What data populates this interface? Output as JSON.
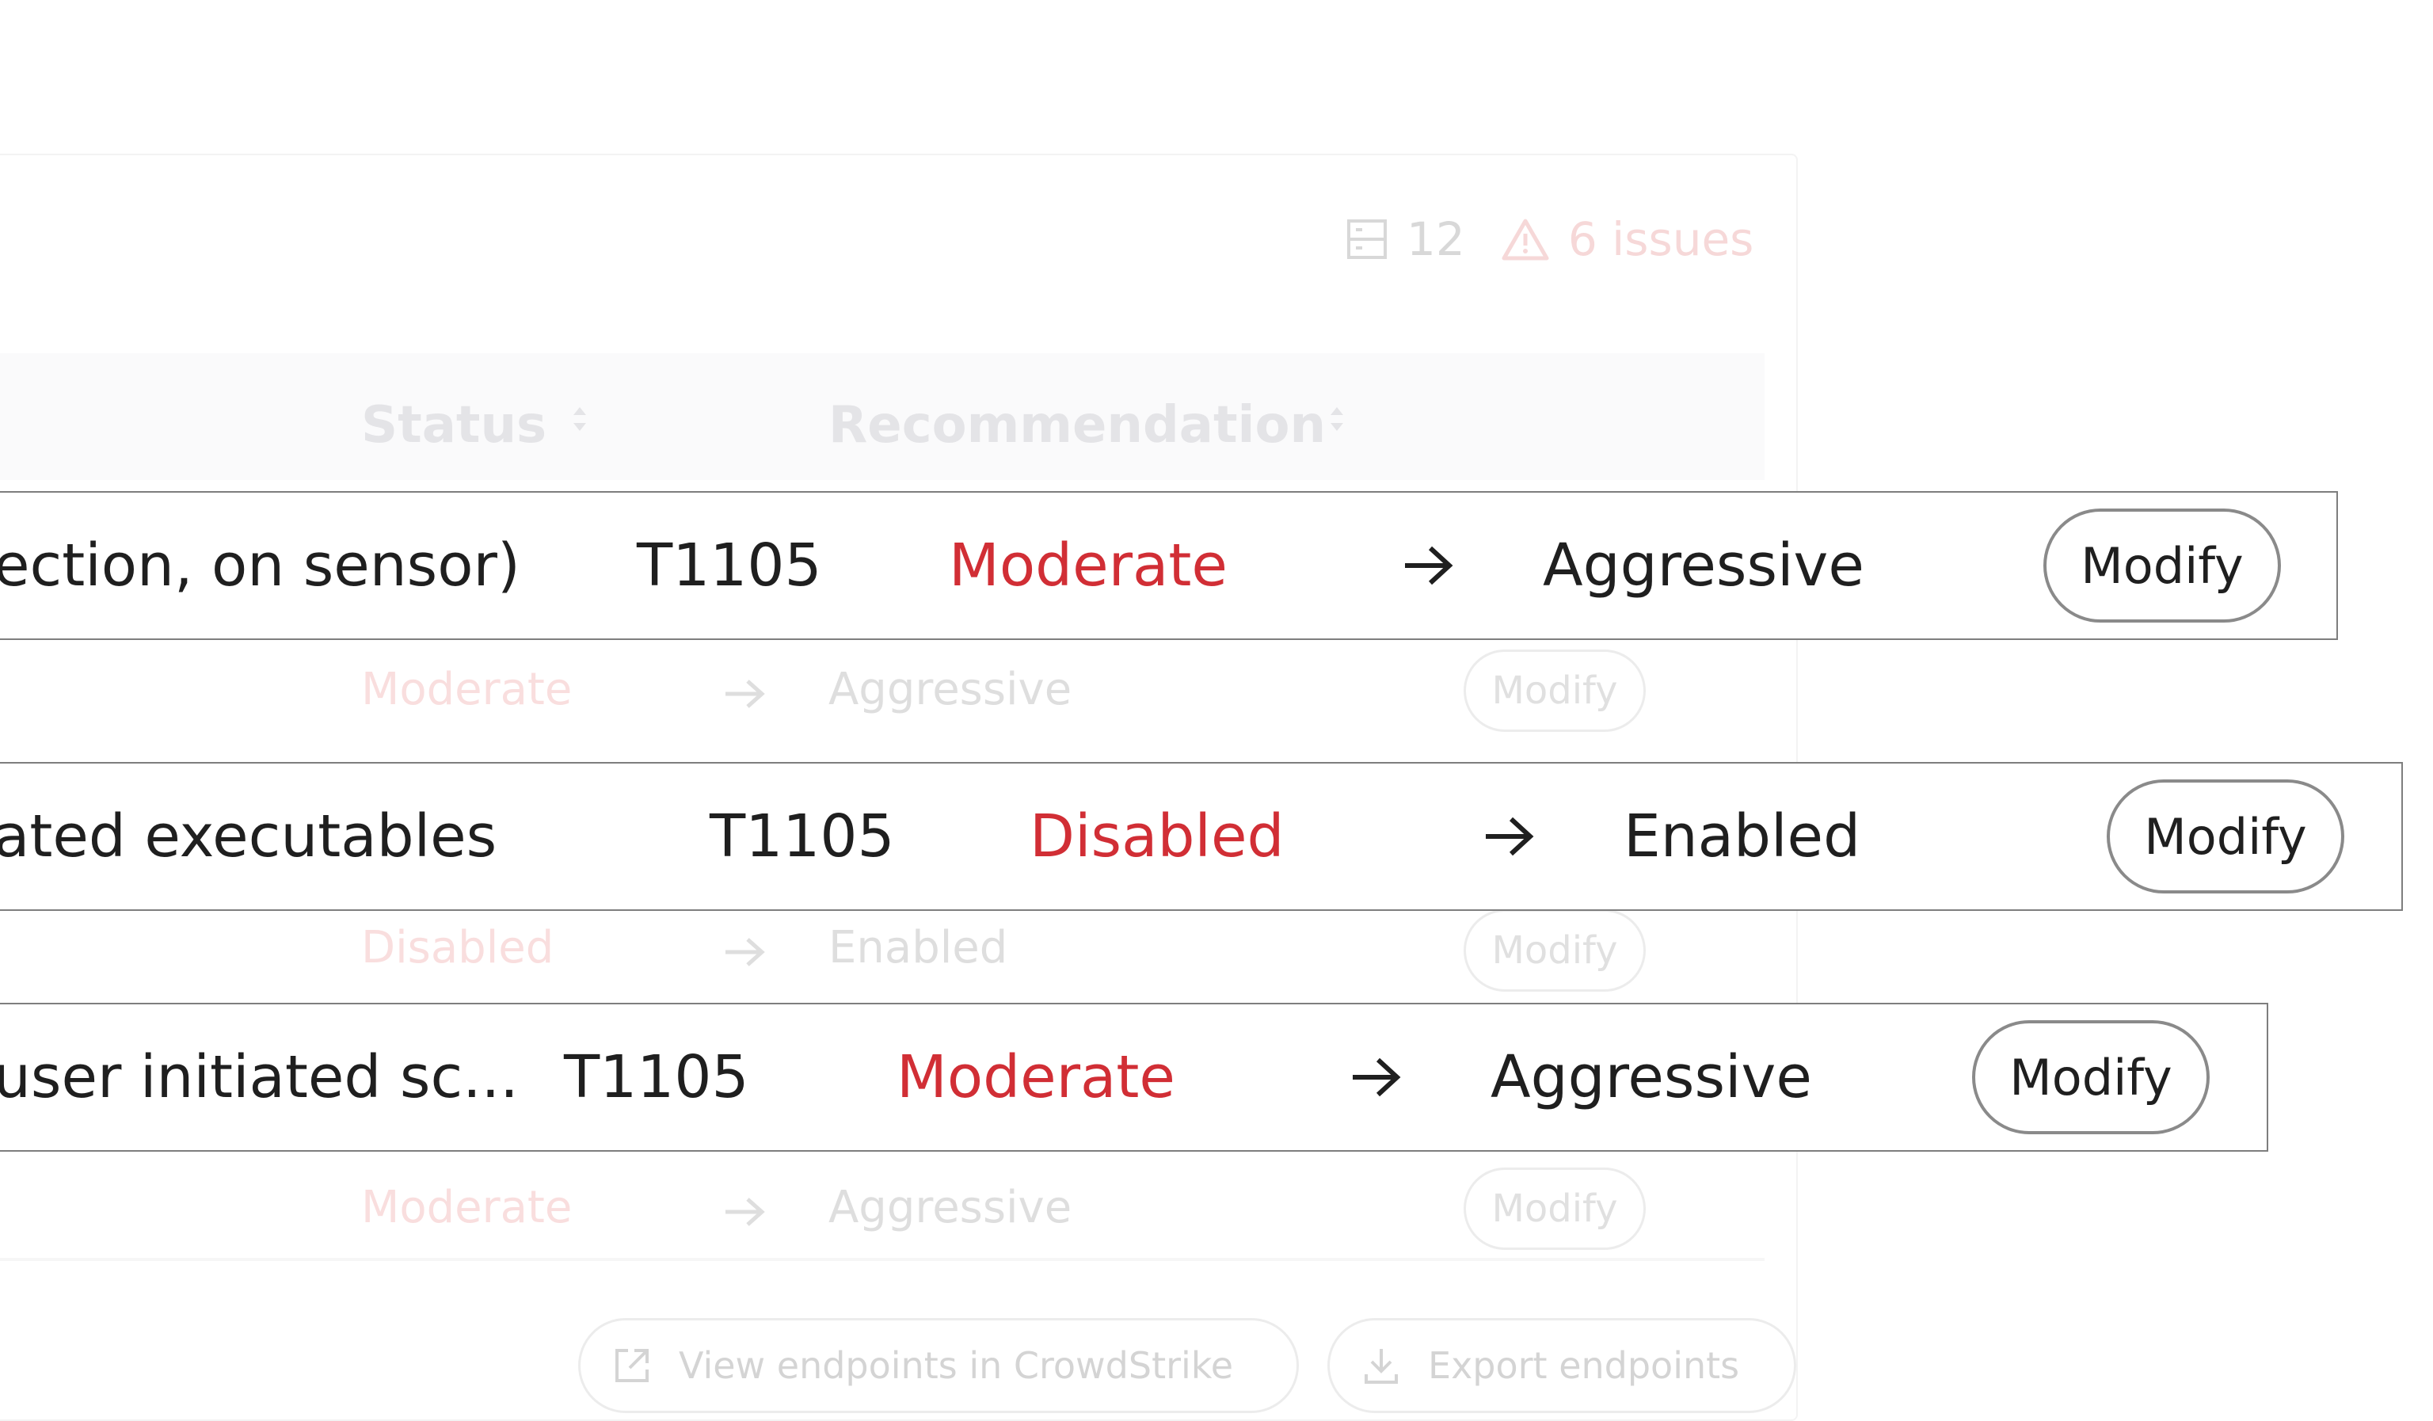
{
  "stats": {
    "endpoint_count": "12",
    "issues_label": "6 issues"
  },
  "columns": {
    "status": "Status",
    "recommendation": "Recommendation"
  },
  "faded_rows": [
    {
      "current": "Moderate",
      "recommended": "Aggressive",
      "button": "Modify"
    },
    {
      "current": "Disabled",
      "recommended": "Enabled",
      "button": "Modify"
    },
    {
      "current": "Moderate",
      "recommended": "Aggressive",
      "button": "Modify"
    }
  ],
  "rows": [
    {
      "setting": "ection, on sensor)",
      "technique": "T1105",
      "current": "Moderate",
      "recommended": "Aggressive",
      "button": "Modify"
    },
    {
      "setting": "ated executables",
      "technique": "T1105",
      "current": "Disabled",
      "recommended": "Enabled",
      "button": "Modify"
    },
    {
      "setting": "user initiated sc...",
      "technique": "T1105",
      "current": "Moderate",
      "recommended": "Aggressive",
      "button": "Modify"
    }
  ],
  "footer": {
    "view_endpoints": "View endpoints in CrowdStrike",
    "export_endpoints": "Export endpoints"
  },
  "colors": {
    "accent_red": "#d12e35",
    "text": "#1f1f1f",
    "border": "#7e7e7e"
  },
  "icons": [
    "server-icon",
    "warning-icon",
    "sort-icon",
    "arrow-right-icon",
    "external-link-icon",
    "download-icon"
  ]
}
